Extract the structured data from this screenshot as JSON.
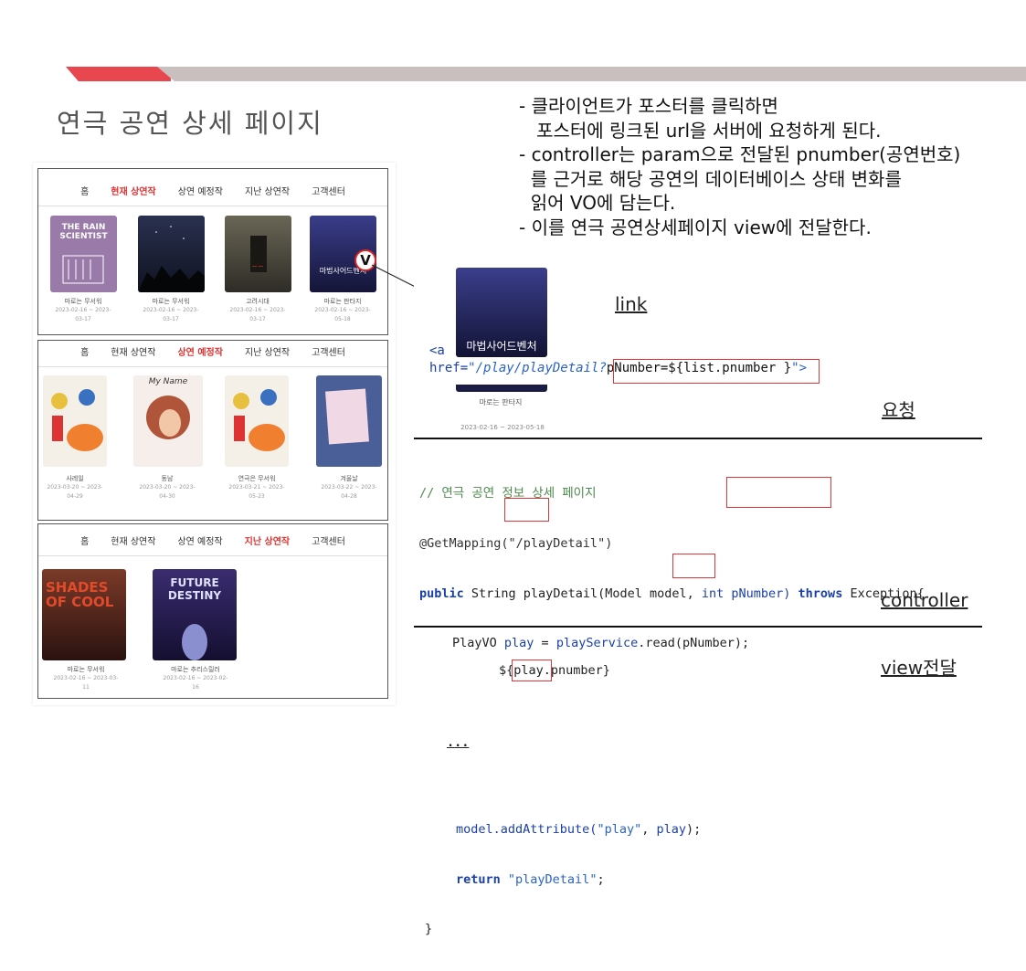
{
  "slide": {
    "title": "연극 공연 상세 페이지",
    "notes": "- 클라이언트가 포스터를 클릭하면\n   포스터에 링크된 url을 서버에 요청하게 된다.\n- controller는 param으로 전달된 pnumber(공연번호)\n  를 근거로 해당 공연의 데이터베이스 상태 변화를\n  읽어 VO에 담는다.\n- 이를 연극 공연상세페이지 view에 전달한다."
  },
  "nav_panels": [
    {
      "items": [
        "홈",
        "현재 상연작",
        "상연 예정작",
        "지난 상연작",
        "고객센터"
      ],
      "active": "현재 상연작"
    },
    {
      "items": [
        "홈",
        "현재 상연작",
        "상연 예정작",
        "지난 상연작",
        "고객센터"
      ],
      "active": "상연 예정작"
    },
    {
      "items": [
        "홈",
        "현재 상연작",
        "상연 예정작",
        "지난 상연작",
        "고객센터"
      ],
      "active": "지난 상연작"
    }
  ],
  "posters_current": [
    {
      "caption": "마로는 무서워",
      "sub": "2023-02-16 ~ 2023-03-17",
      "poster_text": "THE RAIN SCIENTIST",
      "color": "#9a7aa8"
    },
    {
      "caption": "마로는 무서워",
      "sub": "2023-02-16 ~ 2023-03-17",
      "poster_text": "",
      "color": "#1c2033"
    },
    {
      "caption": "고려시대",
      "sub": "2023-02-16 ~ 2023-03-17",
      "poster_text": "",
      "color": "#4c4a42"
    },
    {
      "caption": "마로는 판타지",
      "sub": "2023-02-16 ~ 2023-05-18",
      "poster_text": "마법사어드벤처",
      "color": "#1e2150"
    }
  ],
  "posters_upcoming": [
    {
      "caption": "사레일",
      "sub": "2023-03-20 ~ 2023-04-29",
      "color": "#f4f0e8"
    },
    {
      "caption": "동남",
      "sub": "2023-03-20 ~ 2023-04-30",
      "color": "#f6eeea"
    },
    {
      "caption": "연극은 무서워",
      "sub": "2023-03-21 ~ 2023-05-23",
      "color": "#f4f0e8"
    },
    {
      "caption": "겨울날",
      "sub": "2023-03-22 ~ 2023-04-28",
      "color": "#4a5e98"
    }
  ],
  "posters_past": [
    {
      "caption": "마로는 무서워",
      "sub": "2023-02-16 ~ 2023-03-11",
      "poster_text": "SHADES OF COOL",
      "color": "#5a2420"
    },
    {
      "caption": "마로는 추리스릴러",
      "sub": "2023-02-16 ~ 2023-02-16",
      "poster_text": "FUTURE DESTINY",
      "color": "#231d4e"
    }
  ],
  "marker": "V",
  "code": {
    "link_label": "link",
    "poster_caption": "마로는 판타지",
    "poster_sub": "2023-02-16 ~ 2023-05-18",
    "poster_title": "마법사어드벤처",
    "a_open": "<a",
    "href_attr": "href=",
    "href_value": "\"/play/playDetail?",
    "href_param": "pNumber=${list.pnumber }",
    "href_close": "\">",
    "request_label": "요청",
    "comment": "// 연극 공연 정보 상세 페이지",
    "annotation": "@GetMapping(\"/playDetail\")",
    "sig_kw": "public",
    "sig_rest": " String playDetail(Model model, ",
    "sig_param": "int pNumber)",
    "sig_throws": " throws",
    "sig_exc": " Exception{",
    "line_vo_a": "PlayVO ",
    "line_vo_var": "play",
    "line_vo_b": " = ",
    "line_vo_svc": "playService",
    "line_vo_c": ".read(pNumber);",
    "ellipsis": "...",
    "add_a": "model.addAttribute(",
    "add_str": "\"play\"",
    "add_b": ", ",
    "add_var": "play",
    "add_c": ");",
    "ret_kw": "return",
    "ret_str": " \"playDetail\"",
    "ret_end": ";",
    "brace": "}",
    "controller_label": "controller",
    "view_a": "${",
    "view_var": "play",
    "view_b": ".pnumber}",
    "view_label": "view전달"
  },
  "colors": {
    "accent_red": "#e8474f",
    "bar_grey": "#c9bfbf",
    "code_blue": "#1b3fa8",
    "code_string": "#2a62c9",
    "code_comment": "#4c8a4c",
    "annotation_red": "#e0353a"
  }
}
